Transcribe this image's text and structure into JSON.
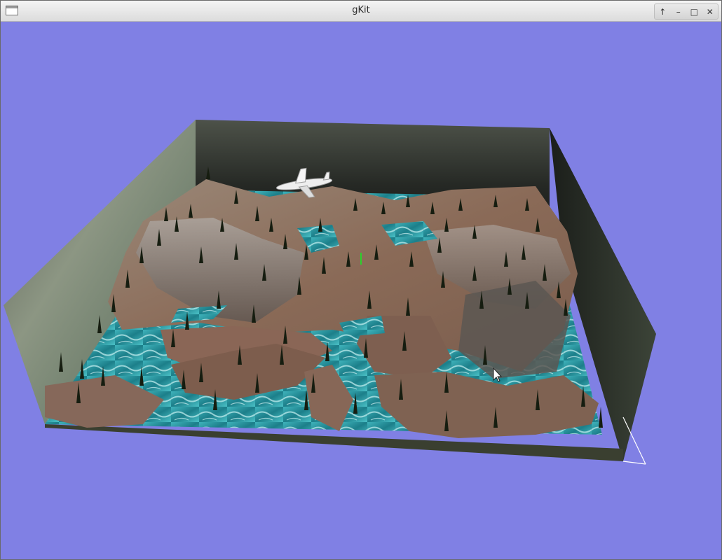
{
  "window": {
    "title": "gKit"
  },
  "controls": {
    "keep_above": "↑",
    "minimize": "–",
    "maximize": "□",
    "close": "✕"
  },
  "colors": {
    "background": "#8080e4",
    "water": "#1f8a93",
    "terrain": "#8d6b58",
    "rock": "#6b6864"
  },
  "scene": {
    "icons": [
      "app-icon",
      "airplane-icon",
      "mouse-cursor-icon"
    ]
  }
}
